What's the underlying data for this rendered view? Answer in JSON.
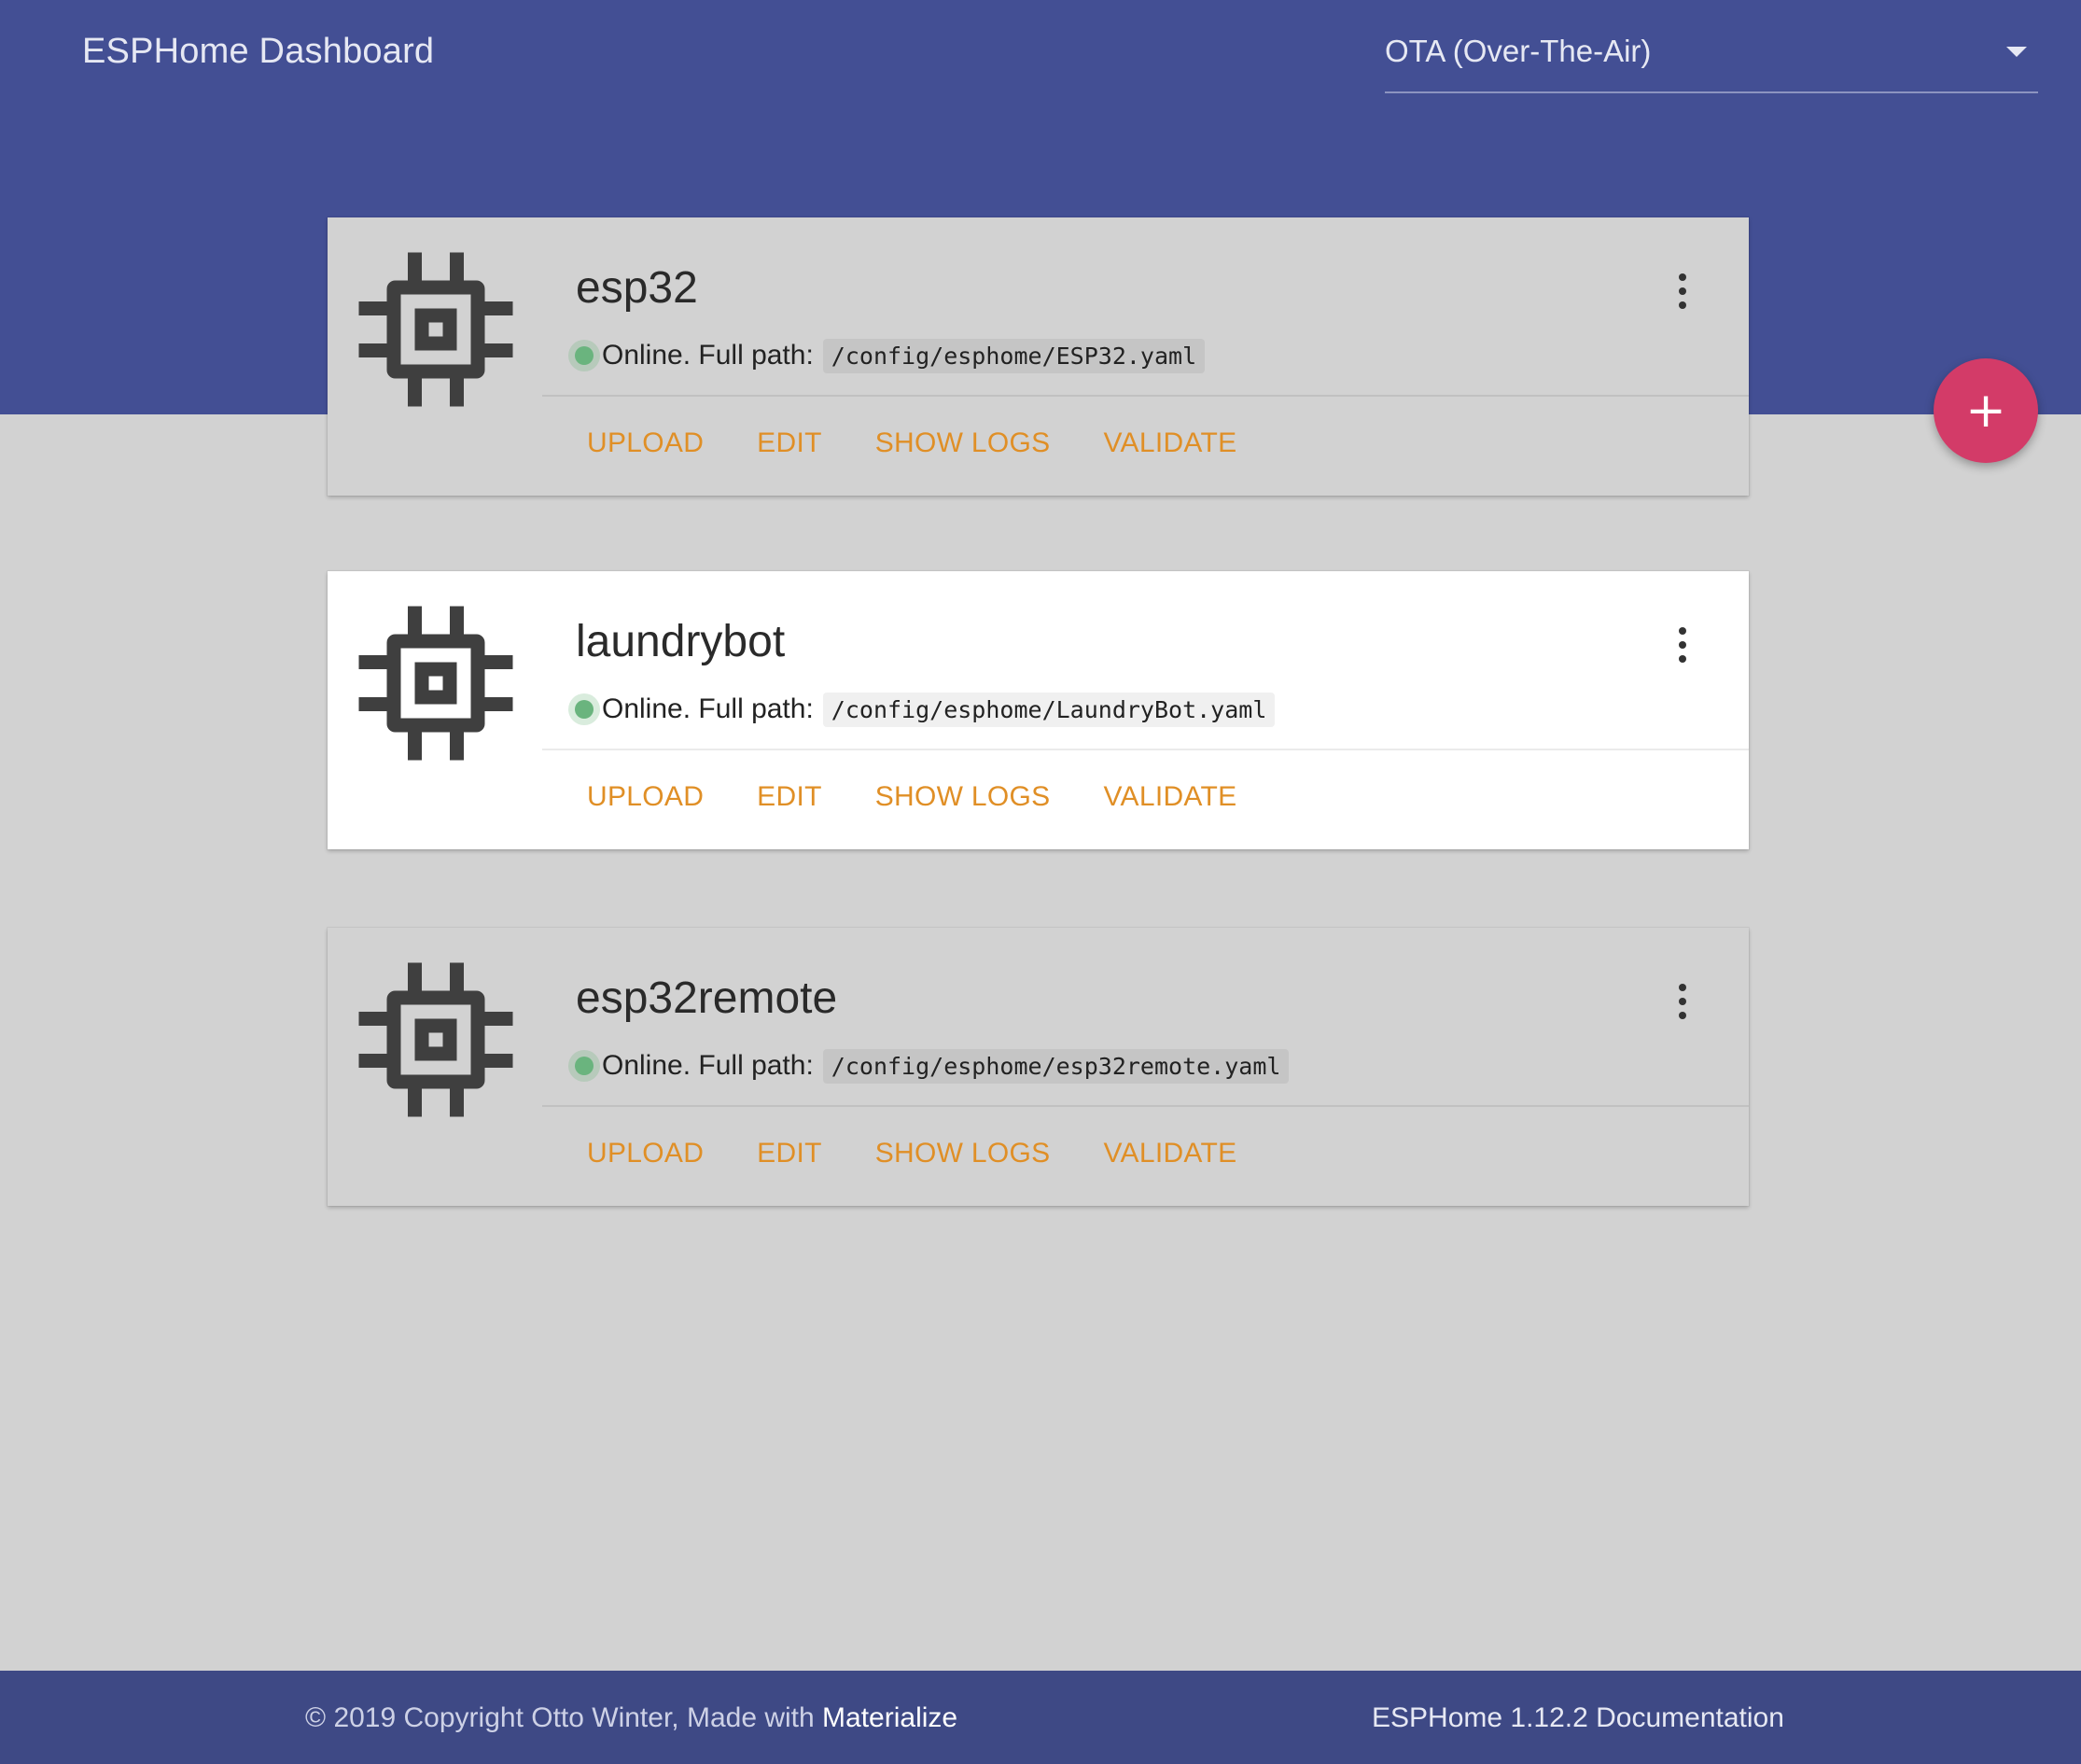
{
  "header": {
    "title": "ESPHome Dashboard",
    "port_select": {
      "value": "OTA (Over-The-Air)"
    }
  },
  "devices": [
    {
      "name": "esp32",
      "status": "Online. Full path:",
      "path": "/config/esphome/ESP32.yaml",
      "actions": [
        "UPLOAD",
        "EDIT",
        "SHOW LOGS",
        "VALIDATE"
      ]
    },
    {
      "name": "laundrybot",
      "status": "Online. Full path:",
      "path": "/config/esphome/LaundryBot.yaml",
      "actions": [
        "UPLOAD",
        "EDIT",
        "SHOW LOGS",
        "VALIDATE"
      ]
    },
    {
      "name": "esp32remote",
      "status": "Online. Full path:",
      "path": "/config/esphome/esp32remote.yaml",
      "actions": [
        "UPLOAD",
        "EDIT",
        "SHOW LOGS",
        "VALIDATE"
      ]
    }
  ],
  "fab": {
    "label": "+",
    "icon": "plus-icon"
  },
  "footer": {
    "copyright_prefix": "© 2019 Copyright Otto Winter, Made with",
    "materialize_link": "Materialize",
    "version_text": "ESPHome 1.12.2",
    "documentation_link": "Documentation"
  },
  "colors": {
    "header_bg": "#434f94",
    "footer_bg": "#3e4985",
    "accent": "#e08f26",
    "fab": "#d33b68",
    "online": "#6ab47e"
  }
}
